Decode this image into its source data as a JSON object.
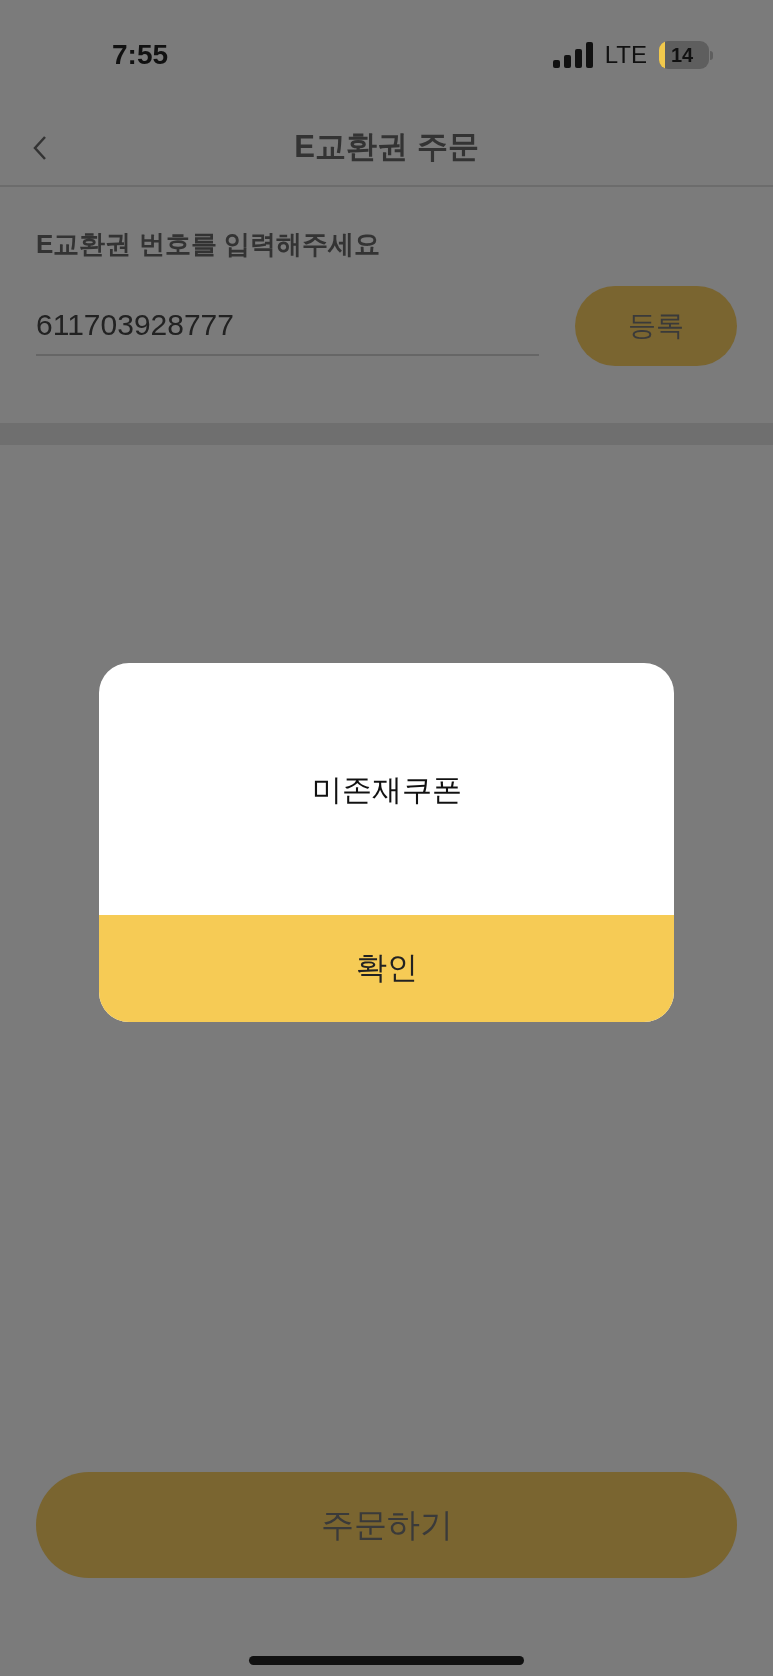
{
  "status_bar": {
    "time": "7:55",
    "network": "LTE",
    "battery": "14"
  },
  "header": {
    "title": "E교환권 주문"
  },
  "voucher": {
    "label": "E교환권 번호를 입력해주세요",
    "value": "611703928777",
    "button": "등록"
  },
  "dialog": {
    "message": "미존재쿠폰",
    "button": "확인"
  },
  "order_button": "주문하기"
}
